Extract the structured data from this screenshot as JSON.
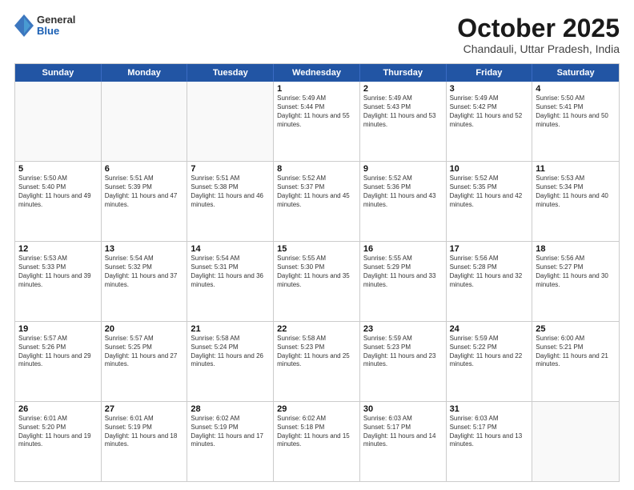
{
  "logo": {
    "general": "General",
    "blue": "Blue"
  },
  "title": "October 2025",
  "location": "Chandauli, Uttar Pradesh, India",
  "days_of_week": [
    "Sunday",
    "Monday",
    "Tuesday",
    "Wednesday",
    "Thursday",
    "Friday",
    "Saturday"
  ],
  "weeks": [
    [
      {
        "day": "",
        "empty": true
      },
      {
        "day": "",
        "empty": true
      },
      {
        "day": "",
        "empty": true
      },
      {
        "day": "1",
        "sunrise": "5:49 AM",
        "sunset": "5:44 PM",
        "daylight": "11 hours and 55 minutes."
      },
      {
        "day": "2",
        "sunrise": "5:49 AM",
        "sunset": "5:43 PM",
        "daylight": "11 hours and 53 minutes."
      },
      {
        "day": "3",
        "sunrise": "5:49 AM",
        "sunset": "5:42 PM",
        "daylight": "11 hours and 52 minutes."
      },
      {
        "day": "4",
        "sunrise": "5:50 AM",
        "sunset": "5:41 PM",
        "daylight": "11 hours and 50 minutes."
      }
    ],
    [
      {
        "day": "5",
        "sunrise": "5:50 AM",
        "sunset": "5:40 PM",
        "daylight": "11 hours and 49 minutes."
      },
      {
        "day": "6",
        "sunrise": "5:51 AM",
        "sunset": "5:39 PM",
        "daylight": "11 hours and 47 minutes."
      },
      {
        "day": "7",
        "sunrise": "5:51 AM",
        "sunset": "5:38 PM",
        "daylight": "11 hours and 46 minutes."
      },
      {
        "day": "8",
        "sunrise": "5:52 AM",
        "sunset": "5:37 PM",
        "daylight": "11 hours and 45 minutes."
      },
      {
        "day": "9",
        "sunrise": "5:52 AM",
        "sunset": "5:36 PM",
        "daylight": "11 hours and 43 minutes."
      },
      {
        "day": "10",
        "sunrise": "5:52 AM",
        "sunset": "5:35 PM",
        "daylight": "11 hours and 42 minutes."
      },
      {
        "day": "11",
        "sunrise": "5:53 AM",
        "sunset": "5:34 PM",
        "daylight": "11 hours and 40 minutes."
      }
    ],
    [
      {
        "day": "12",
        "sunrise": "5:53 AM",
        "sunset": "5:33 PM",
        "daylight": "11 hours and 39 minutes."
      },
      {
        "day": "13",
        "sunrise": "5:54 AM",
        "sunset": "5:32 PM",
        "daylight": "11 hours and 37 minutes."
      },
      {
        "day": "14",
        "sunrise": "5:54 AM",
        "sunset": "5:31 PM",
        "daylight": "11 hours and 36 minutes."
      },
      {
        "day": "15",
        "sunrise": "5:55 AM",
        "sunset": "5:30 PM",
        "daylight": "11 hours and 35 minutes."
      },
      {
        "day": "16",
        "sunrise": "5:55 AM",
        "sunset": "5:29 PM",
        "daylight": "11 hours and 33 minutes."
      },
      {
        "day": "17",
        "sunrise": "5:56 AM",
        "sunset": "5:28 PM",
        "daylight": "11 hours and 32 minutes."
      },
      {
        "day": "18",
        "sunrise": "5:56 AM",
        "sunset": "5:27 PM",
        "daylight": "11 hours and 30 minutes."
      }
    ],
    [
      {
        "day": "19",
        "sunrise": "5:57 AM",
        "sunset": "5:26 PM",
        "daylight": "11 hours and 29 minutes."
      },
      {
        "day": "20",
        "sunrise": "5:57 AM",
        "sunset": "5:25 PM",
        "daylight": "11 hours and 27 minutes."
      },
      {
        "day": "21",
        "sunrise": "5:58 AM",
        "sunset": "5:24 PM",
        "daylight": "11 hours and 26 minutes."
      },
      {
        "day": "22",
        "sunrise": "5:58 AM",
        "sunset": "5:23 PM",
        "daylight": "11 hours and 25 minutes."
      },
      {
        "day": "23",
        "sunrise": "5:59 AM",
        "sunset": "5:23 PM",
        "daylight": "11 hours and 23 minutes."
      },
      {
        "day": "24",
        "sunrise": "5:59 AM",
        "sunset": "5:22 PM",
        "daylight": "11 hours and 22 minutes."
      },
      {
        "day": "25",
        "sunrise": "6:00 AM",
        "sunset": "5:21 PM",
        "daylight": "11 hours and 21 minutes."
      }
    ],
    [
      {
        "day": "26",
        "sunrise": "6:01 AM",
        "sunset": "5:20 PM",
        "daylight": "11 hours and 19 minutes."
      },
      {
        "day": "27",
        "sunrise": "6:01 AM",
        "sunset": "5:19 PM",
        "daylight": "11 hours and 18 minutes."
      },
      {
        "day": "28",
        "sunrise": "6:02 AM",
        "sunset": "5:19 PM",
        "daylight": "11 hours and 17 minutes."
      },
      {
        "day": "29",
        "sunrise": "6:02 AM",
        "sunset": "5:18 PM",
        "daylight": "11 hours and 15 minutes."
      },
      {
        "day": "30",
        "sunrise": "6:03 AM",
        "sunset": "5:17 PM",
        "daylight": "11 hours and 14 minutes."
      },
      {
        "day": "31",
        "sunrise": "6:03 AM",
        "sunset": "5:17 PM",
        "daylight": "11 hours and 13 minutes."
      },
      {
        "day": "",
        "empty": true
      }
    ]
  ]
}
